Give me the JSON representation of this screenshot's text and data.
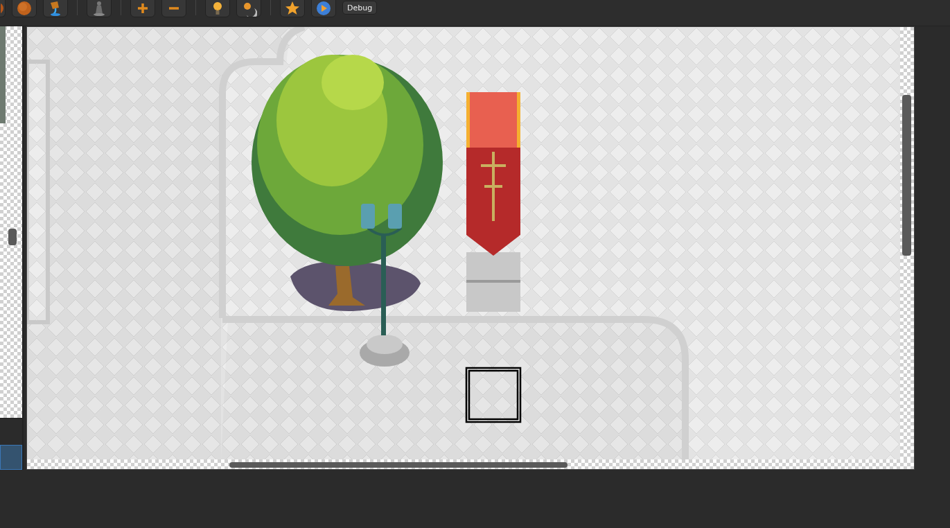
{
  "toolbar": {
    "debug_button": "Debug"
  }
}
